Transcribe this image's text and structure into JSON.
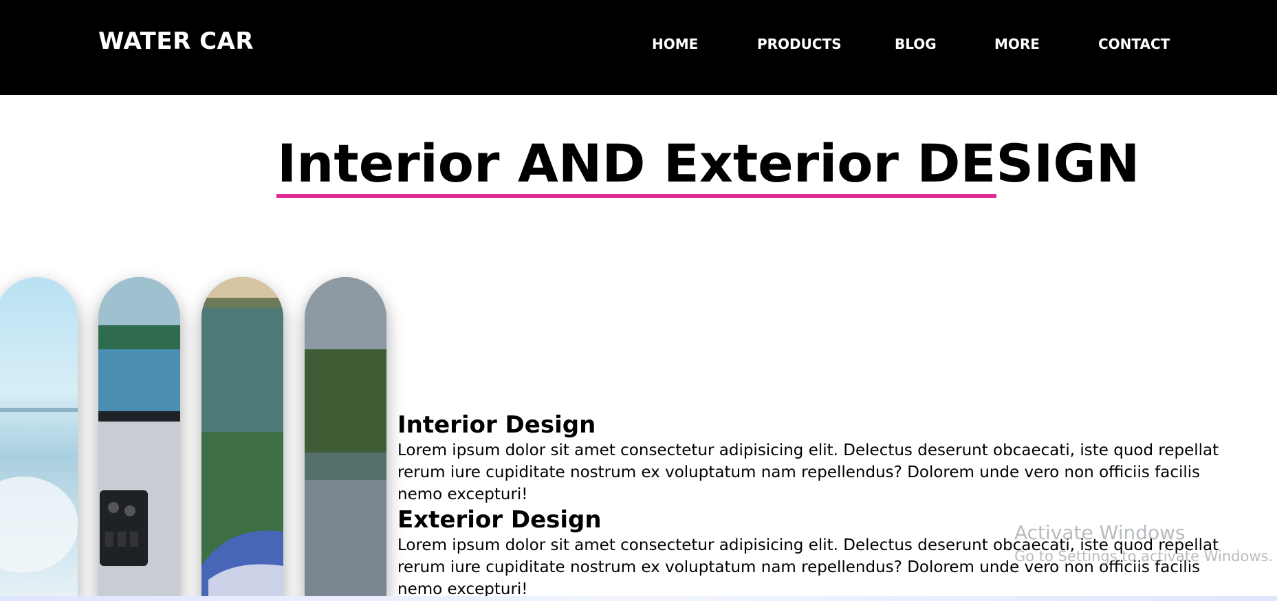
{
  "header": {
    "brand": "WATER CAR",
    "nav": [
      "HOME",
      "PRODUCTS",
      "BLOG",
      "MORE",
      "CONTACT"
    ]
  },
  "hero": {
    "title": "Interior AND Exterior DESIGN",
    "accent": "#e02a96"
  },
  "gallery": {
    "images": [
      "sea-spray-image",
      "boat-cockpit-image",
      "lake-water-image",
      "river-bank-image"
    ]
  },
  "sections": [
    {
      "heading": "Interior Design",
      "body": "Lorem ipsum dolor sit amet consectetur adipisicing elit. Delectus deserunt obcaecati, iste quod repellat rerum iure cupiditate nostrum ex voluptatum nam repellendus? Dolorem unde vero non officiis facilis nemo excepturi!"
    },
    {
      "heading": "Exterior Design",
      "body": "Lorem ipsum dolor sit amet consectetur adipisicing elit. Delectus deserunt obcaecati, iste quod repellat rerum iure cupiditate nostrum ex voluptatum nam repellendus? Dolorem unde vero non officiis facilis nemo excepturi!"
    }
  ],
  "watermark": {
    "title": "Activate Windows",
    "subtitle": "Go to Settings to activate Windows."
  },
  "colors": {
    "header_bg": "#000000",
    "accent": "#e02a96",
    "text": "#000000"
  }
}
